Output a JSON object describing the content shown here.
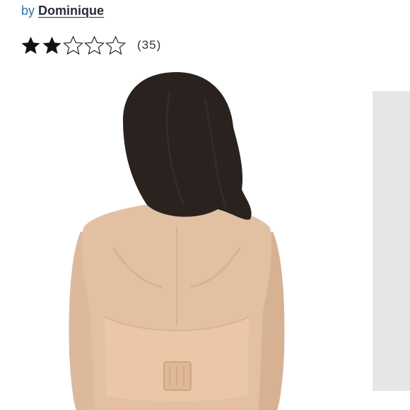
{
  "header": {
    "by_prefix": "by",
    "brand_name": "Dominique"
  },
  "rating": {
    "stars_filled": 2,
    "stars_total": 5,
    "review_count": "(35)"
  },
  "gallery": {
    "image": "product-photo-back-view",
    "next_preview_color": "#e6e6e6"
  },
  "colors": {
    "link": "#2f6fb3",
    "brand_text": "#2a2a3a",
    "star": "#111111"
  }
}
